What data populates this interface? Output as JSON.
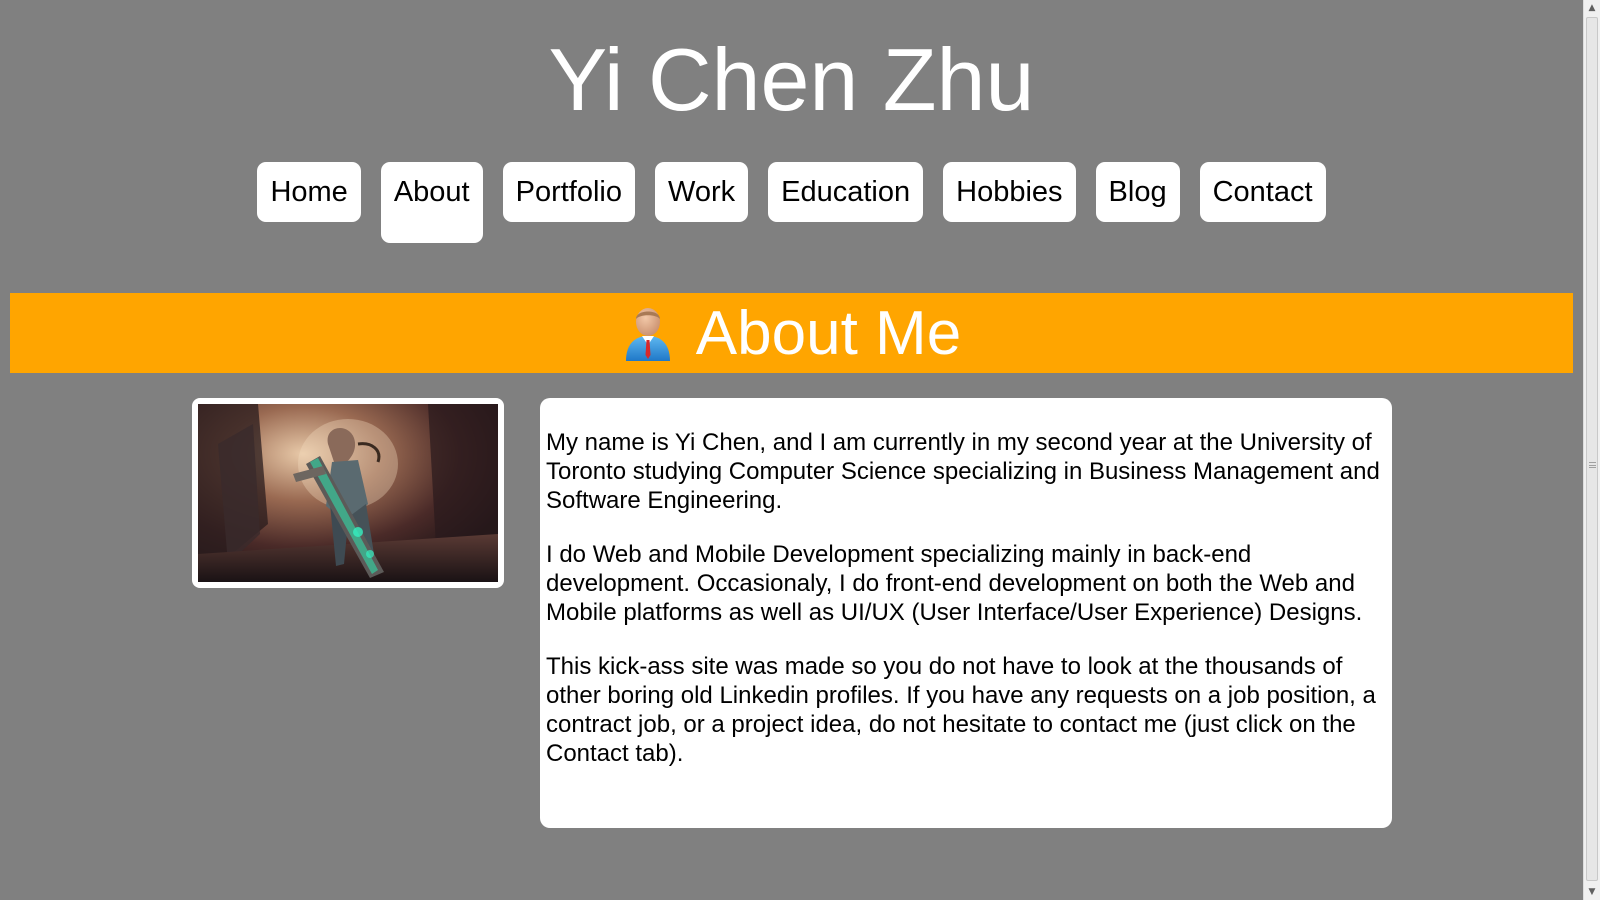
{
  "site": {
    "title": "Yi Chen Zhu"
  },
  "nav": {
    "items": [
      {
        "label": "Home",
        "active": false
      },
      {
        "label": "About",
        "active": true
      },
      {
        "label": "Portfolio",
        "active": false
      },
      {
        "label": "Work",
        "active": false
      },
      {
        "label": "Education",
        "active": false
      },
      {
        "label": "Hobbies",
        "active": false
      },
      {
        "label": "Blog",
        "active": false
      },
      {
        "label": "Contact",
        "active": false
      }
    ]
  },
  "section": {
    "title": "About Me",
    "icon": "user-businessman-icon",
    "banner_color": "#ffa500"
  },
  "about": {
    "paragraphs": [
      "My name is Yi Chen, and I am currently in my second year at the University of Toronto studying Computer Science specializing in Business Management and Software Engineering.",
      "I do Web and Mobile Development specializing mainly in back-end development. Occasionaly, I do front-end development on both the Web and Mobile platforms as well as UI/UX (User Interface/User Experience) Designs.",
      "This kick-ass site was made so you do not have to look at the thousands of other boring old Linkedin profiles. If you have any requests on a job position, a contract job, or a project idea, do not hesitate to contact me (just click on the Contact tab)."
    ]
  },
  "colors": {
    "page_background": "#808080",
    "card_background": "#ffffff",
    "accent": "#ffa500"
  }
}
